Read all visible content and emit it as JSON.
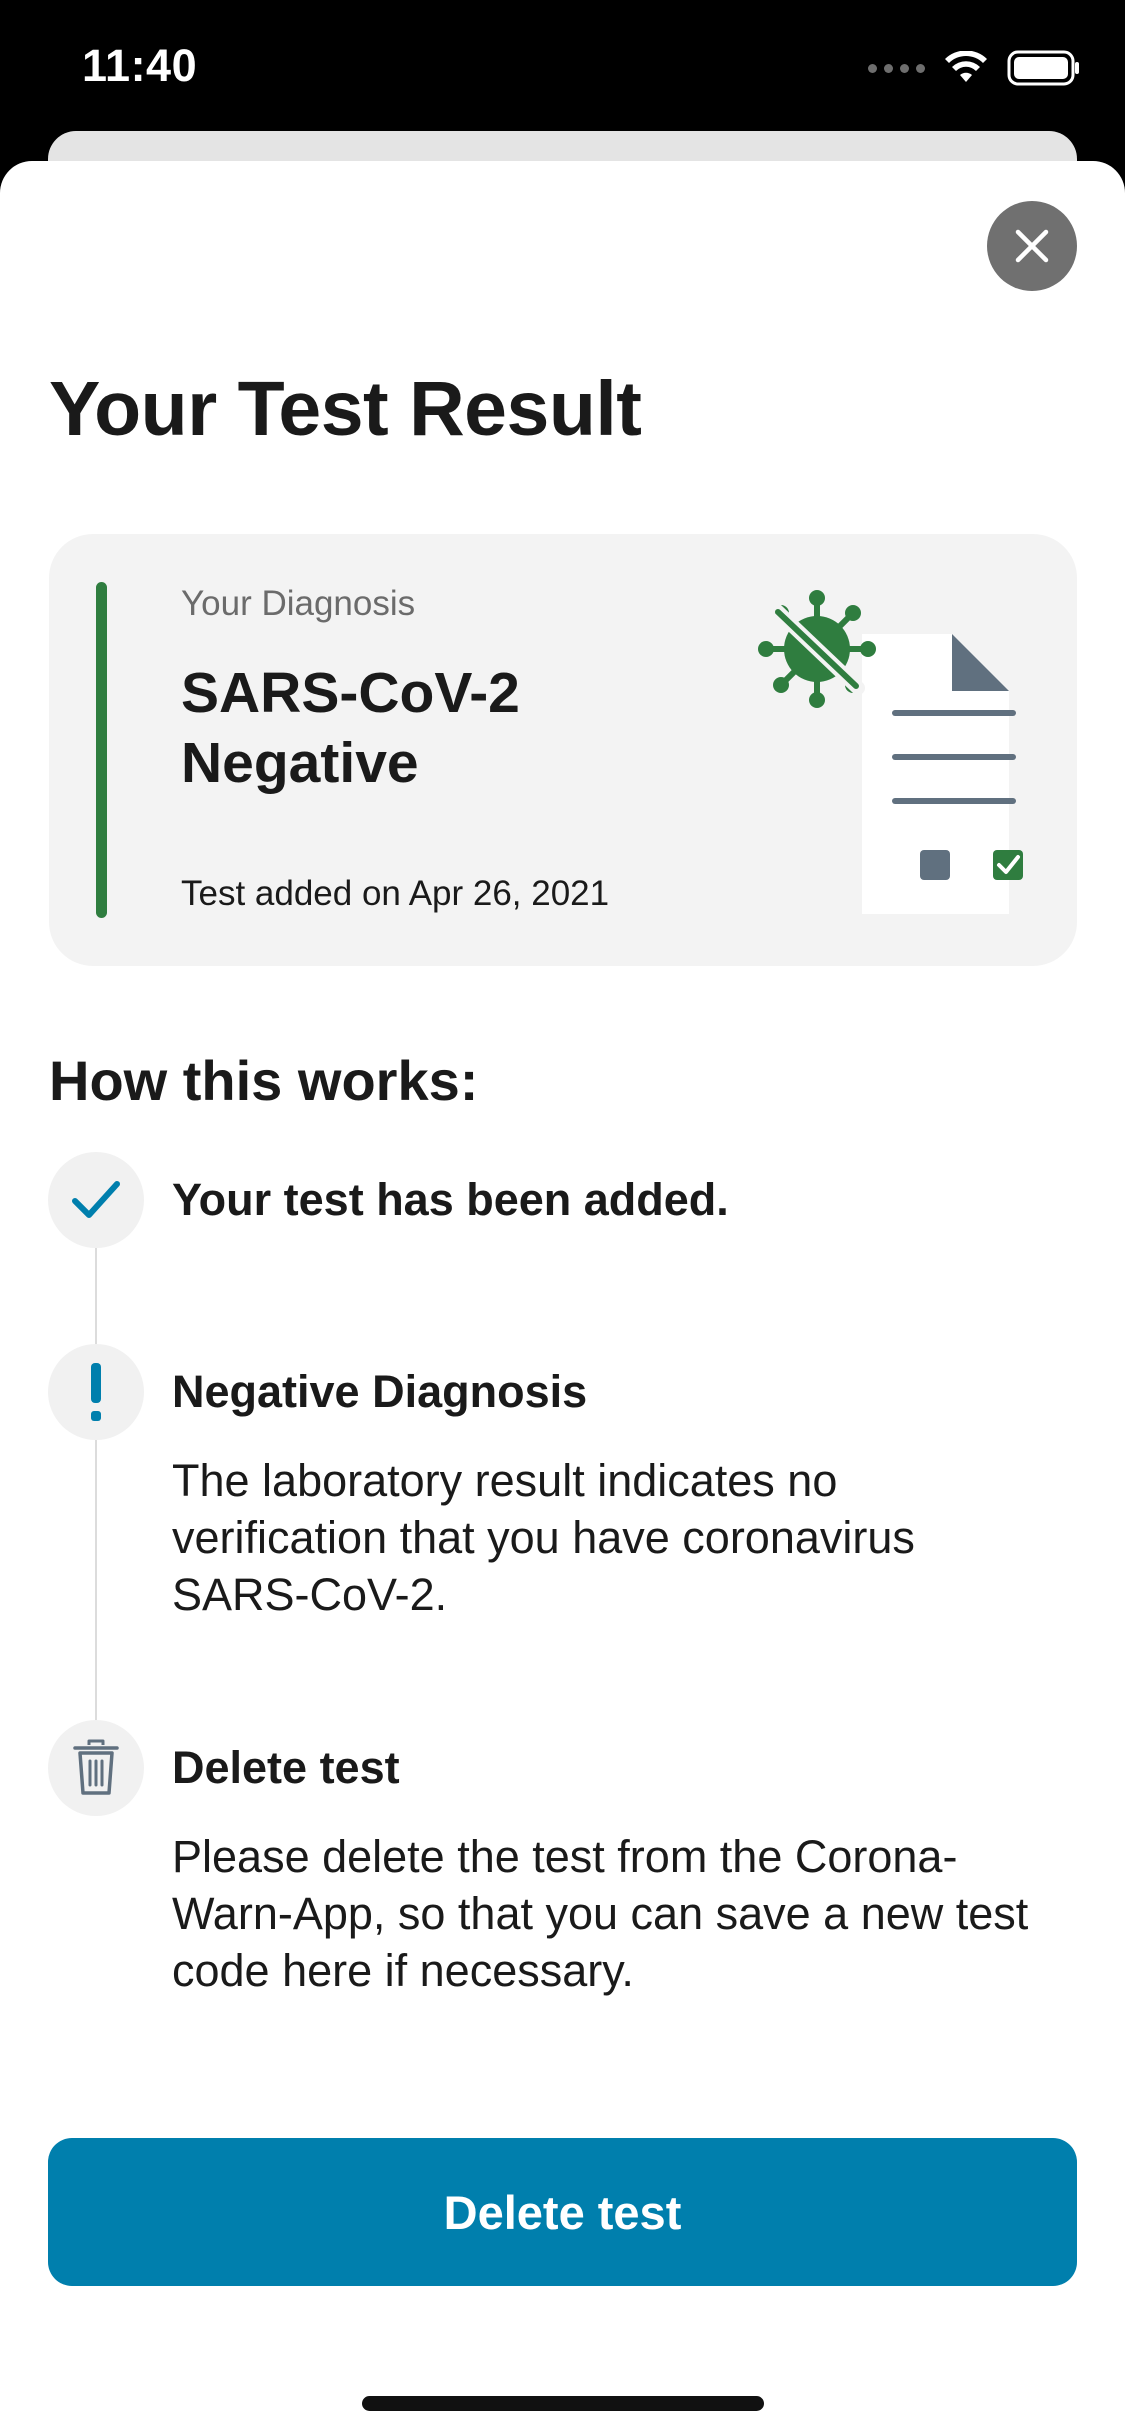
{
  "status_bar": {
    "time": "11:40",
    "icons": [
      "cellular-signal-icon",
      "wifi-icon",
      "battery-icon"
    ]
  },
  "header": {
    "close_icon": "close-icon",
    "title": "Your Test Result"
  },
  "result_card": {
    "label": "Your Diagnosis",
    "value_line1": "SARS-CoV-2",
    "value_line2": "Negative",
    "date_text": "Test added on Apr 26, 2021",
    "stripe_color": "#2f7d3f",
    "illustration_icon": "negative-test-document-illustration"
  },
  "how_it_works": {
    "title": "How this works:",
    "steps": [
      {
        "icon": "checkmark-icon",
        "title": "Your test has been added.",
        "body": ""
      },
      {
        "icon": "exclamation-icon",
        "title": "Negative Diagnosis",
        "body": "The laboratory result indicates no verification that you have coronavirus SARS-CoV-2."
      },
      {
        "icon": "trash-icon",
        "title": "Delete test",
        "body": "Please delete the test from the Corona-Warn-App, so that you can save a new test code here if necessary."
      }
    ]
  },
  "footer": {
    "delete_button_label": "Delete test",
    "button_color": "#007fad"
  },
  "colors": {
    "accent": "#007fad",
    "negative_green": "#2f7d3f",
    "card_background": "#f3f3f3"
  }
}
